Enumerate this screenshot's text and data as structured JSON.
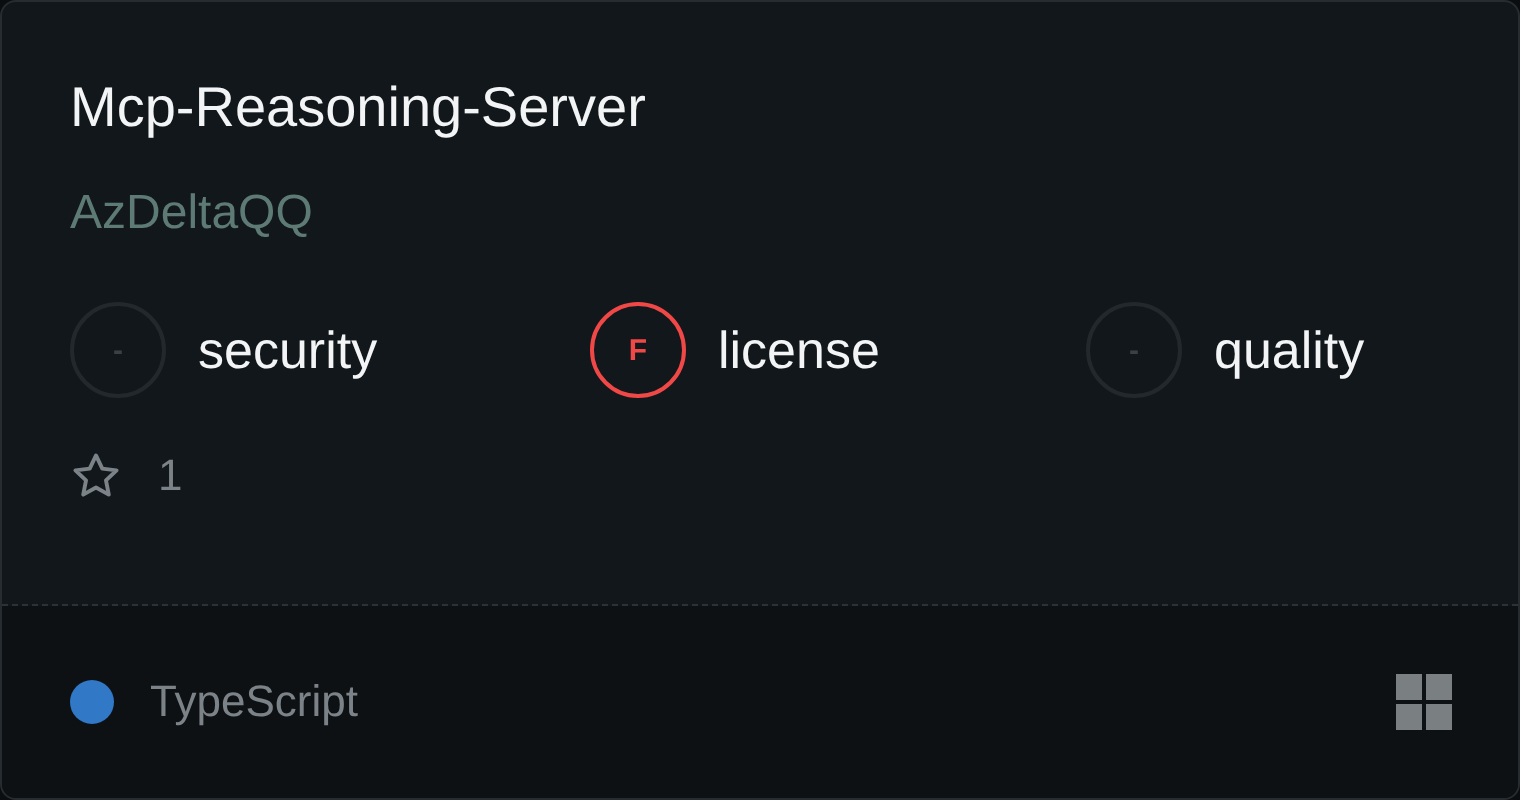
{
  "title": "Mcp-Reasoning-Server",
  "author": "AzDeltaQQ",
  "scores": [
    {
      "grade": "-",
      "label": "security",
      "color": "#22282b"
    },
    {
      "grade": "F",
      "label": "license",
      "color": "#f04747"
    },
    {
      "grade": "-",
      "label": "quality",
      "color": "#22282b"
    }
  ],
  "stars": "1",
  "language": {
    "name": "TypeScript",
    "color": "#3178c6"
  }
}
